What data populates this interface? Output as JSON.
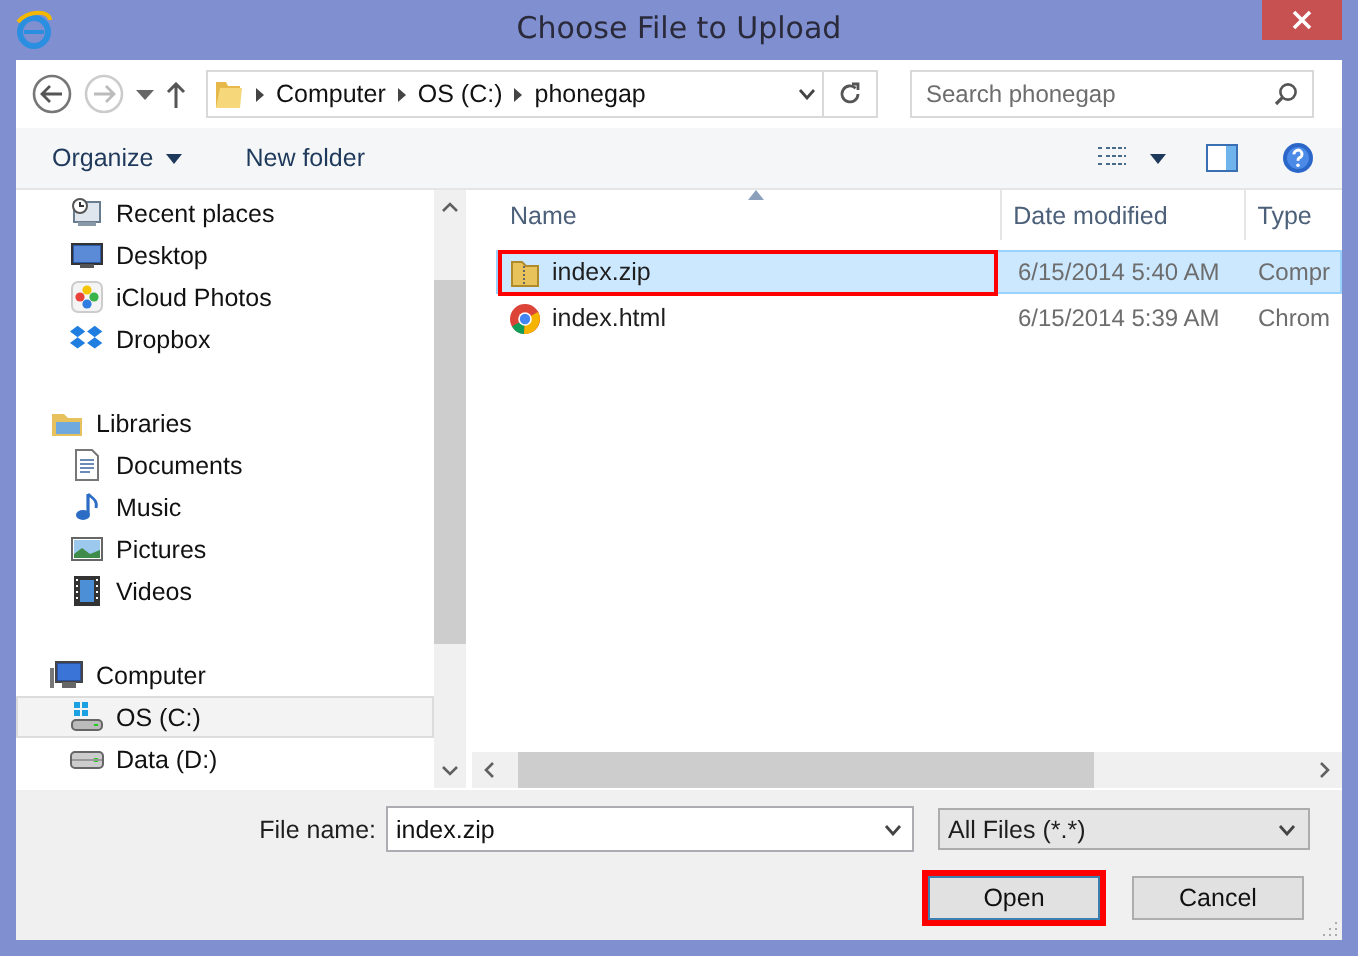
{
  "window": {
    "title": "Choose File to Upload"
  },
  "address_bar": {
    "path": [
      "Computer",
      "OS (C:)",
      "phonegap"
    ]
  },
  "search": {
    "placeholder": "Search phonegap"
  },
  "toolbar": {
    "organize": "Organize",
    "new_folder": "New folder"
  },
  "sidebar": {
    "sections": [
      {
        "children": [
          {
            "label": "Recent places",
            "kind": "recent",
            "selected": false
          },
          {
            "label": "Desktop",
            "kind": "desktop",
            "selected": false
          },
          {
            "label": "iCloud Photos",
            "kind": "photos",
            "selected": false
          },
          {
            "label": "Dropbox",
            "kind": "dropbox",
            "selected": false
          }
        ]
      },
      {
        "label": "Libraries",
        "kind": "libraries",
        "children": [
          {
            "label": "Documents",
            "kind": "documents",
            "selected": false
          },
          {
            "label": "Music",
            "kind": "music",
            "selected": false
          },
          {
            "label": "Pictures",
            "kind": "pictures",
            "selected": false
          },
          {
            "label": "Videos",
            "kind": "videos",
            "selected": false
          }
        ]
      },
      {
        "label": "Computer",
        "kind": "computer",
        "children": [
          {
            "label": "OS (C:)",
            "kind": "osdrive",
            "selected": true
          },
          {
            "label": "Data (D:)",
            "kind": "drive",
            "selected": false
          }
        ]
      }
    ]
  },
  "table": {
    "columns": [
      "Name",
      "Date modified",
      "Type"
    ],
    "rows": [
      {
        "name": "index.zip",
        "kind": "zip",
        "date_modified": "6/15/2014 5:40 AM",
        "type": "Compr",
        "selected": true,
        "annotated": true
      },
      {
        "name": "index.html",
        "kind": "chrome",
        "date_modified": "6/15/2014 5:39 AM",
        "type": "Chrom",
        "selected": false,
        "annotated": false
      }
    ]
  },
  "footer": {
    "file_name_label": "File name:",
    "file_name": "index.zip",
    "file_type": "All Files (*.*)",
    "buttons": [
      {
        "label": "Open",
        "annotated": true
      },
      {
        "label": "Cancel",
        "annotated": false
      }
    ]
  }
}
